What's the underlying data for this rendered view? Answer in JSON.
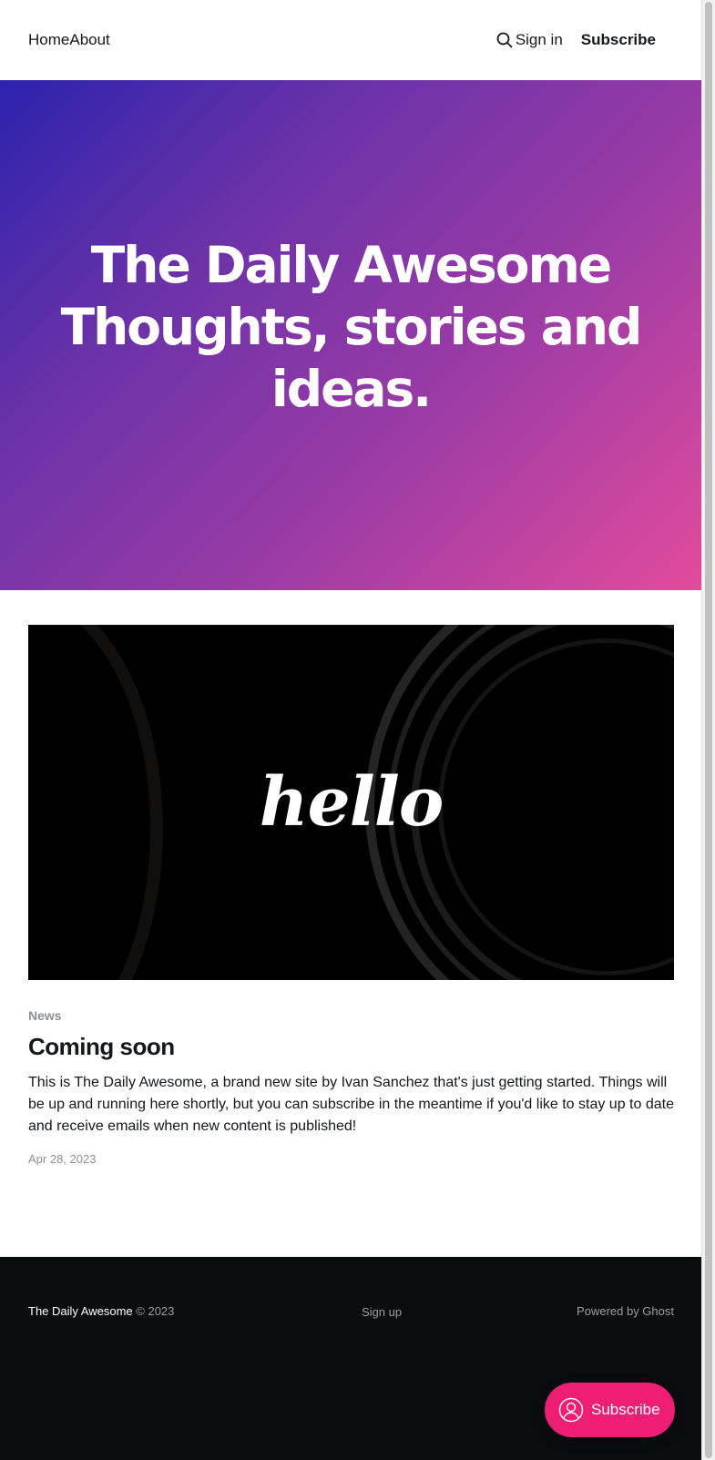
{
  "header": {
    "nav": [
      "Home",
      "About"
    ],
    "signin_label": "Sign in",
    "subscribe_label": "Subscribe",
    "search_icon": "search-icon"
  },
  "hero": {
    "title": "The Daily Awesome Thoughts, stories and ideas.",
    "gradient_start": "#2b22ad",
    "gradient_end": "#e24b9c"
  },
  "post": {
    "image_text": "hello",
    "tag": "News",
    "title": "Coming soon",
    "excerpt": "This is The Daily Awesome, a brand new site by Ivan Sanchez that's just getting started. Things will be up and running here shortly, but you can subscribe in the meantime if you'd like to stay up to date and receive emails when new content is published!",
    "date": "Apr 28, 2023"
  },
  "footer": {
    "site_name": "The Daily Awesome",
    "copyright": "© 2023",
    "signup_label": "Sign up",
    "powered_by": "Powered by Ghost"
  },
  "portal": {
    "label": "Subscribe",
    "icon": "user-icon",
    "color": "#ed1e74"
  }
}
